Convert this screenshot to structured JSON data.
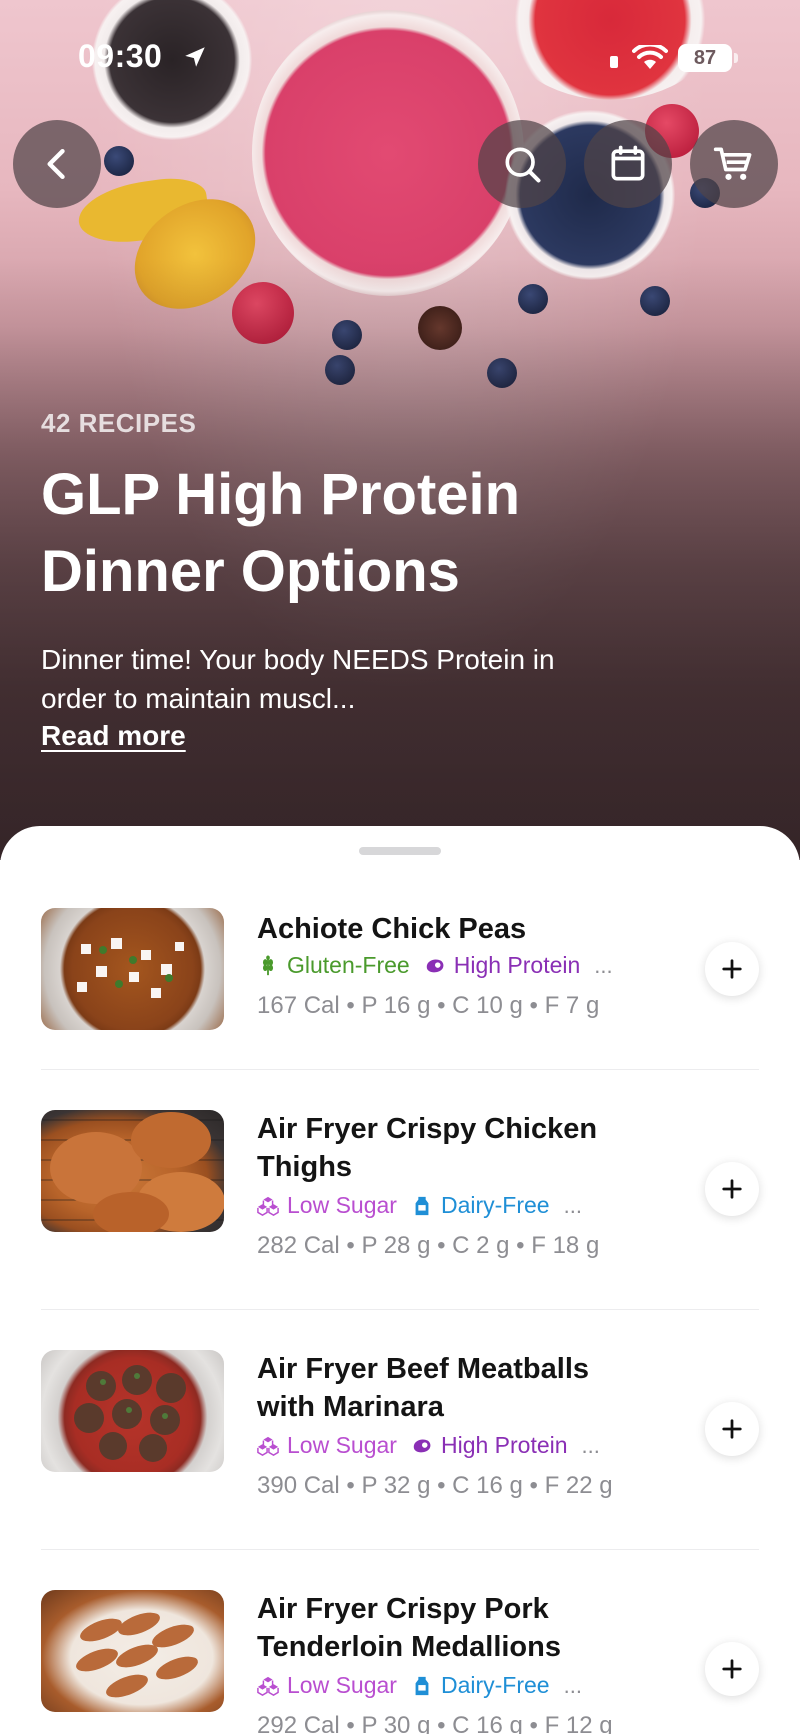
{
  "status_bar": {
    "time": "09:30",
    "battery": "87"
  },
  "header": {
    "recipe_count": "42 RECIPES",
    "title": "GLP High Protein Dinner Options",
    "description": "Dinner time! Your body NEEDS Protein in order to maintain muscl...",
    "read_more": "Read more"
  },
  "recipes": [
    {
      "name": "Achiote Chick Peas",
      "tags": [
        {
          "label": "Gluten-Free",
          "icon": "wheat-icon",
          "color": "#4a9a2c"
        },
        {
          "label": "High Protein",
          "icon": "meat-icon",
          "color": "#8a2fb5"
        }
      ],
      "more": "...",
      "macros": "167 Cal • P 16 g • C 10 g • F 7 g"
    },
    {
      "name": "Air Fryer Crispy Chicken Thighs",
      "tags": [
        {
          "label": "Low Sugar",
          "icon": "sugar-cubes-icon",
          "color": "#b94ed0"
        },
        {
          "label": "Dairy-Free",
          "icon": "milk-carton-icon",
          "color": "#1f8fd6"
        }
      ],
      "more": "...",
      "macros": "282 Cal • P 28 g • C 2 g • F 18 g"
    },
    {
      "name": "Air Fryer Beef Meatballs with Marinara",
      "tags": [
        {
          "label": "Low Sugar",
          "icon": "sugar-cubes-icon",
          "color": "#b94ed0"
        },
        {
          "label": "High Protein",
          "icon": "meat-icon",
          "color": "#8a2fb5"
        }
      ],
      "more": "...",
      "macros": "390 Cal • P 32 g • C 16 g • F 22 g"
    },
    {
      "name": "Air Fryer Crispy Pork Tenderloin Medallions",
      "tags": [
        {
          "label": "Low Sugar",
          "icon": "sugar-cubes-icon",
          "color": "#b94ed0"
        },
        {
          "label": "Dairy-Free",
          "icon": "milk-carton-icon",
          "color": "#1f8fd6"
        }
      ],
      "more": "...",
      "macros": "292 Cal • P 30 g • C 16 g • F 12 g"
    }
  ]
}
